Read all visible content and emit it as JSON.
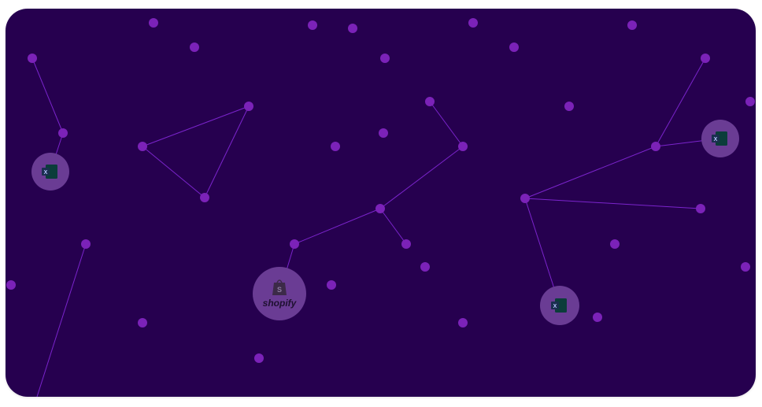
{
  "colors": {
    "background": "#26004f",
    "node": "#7b22b8",
    "edge": "#8a2be2",
    "badge": "#6a3c94"
  },
  "icons": {
    "excel": "excel-icon",
    "shopify": "shopify-bag-icon"
  },
  "shopify_badge": {
    "label": "shopify"
  }
}
